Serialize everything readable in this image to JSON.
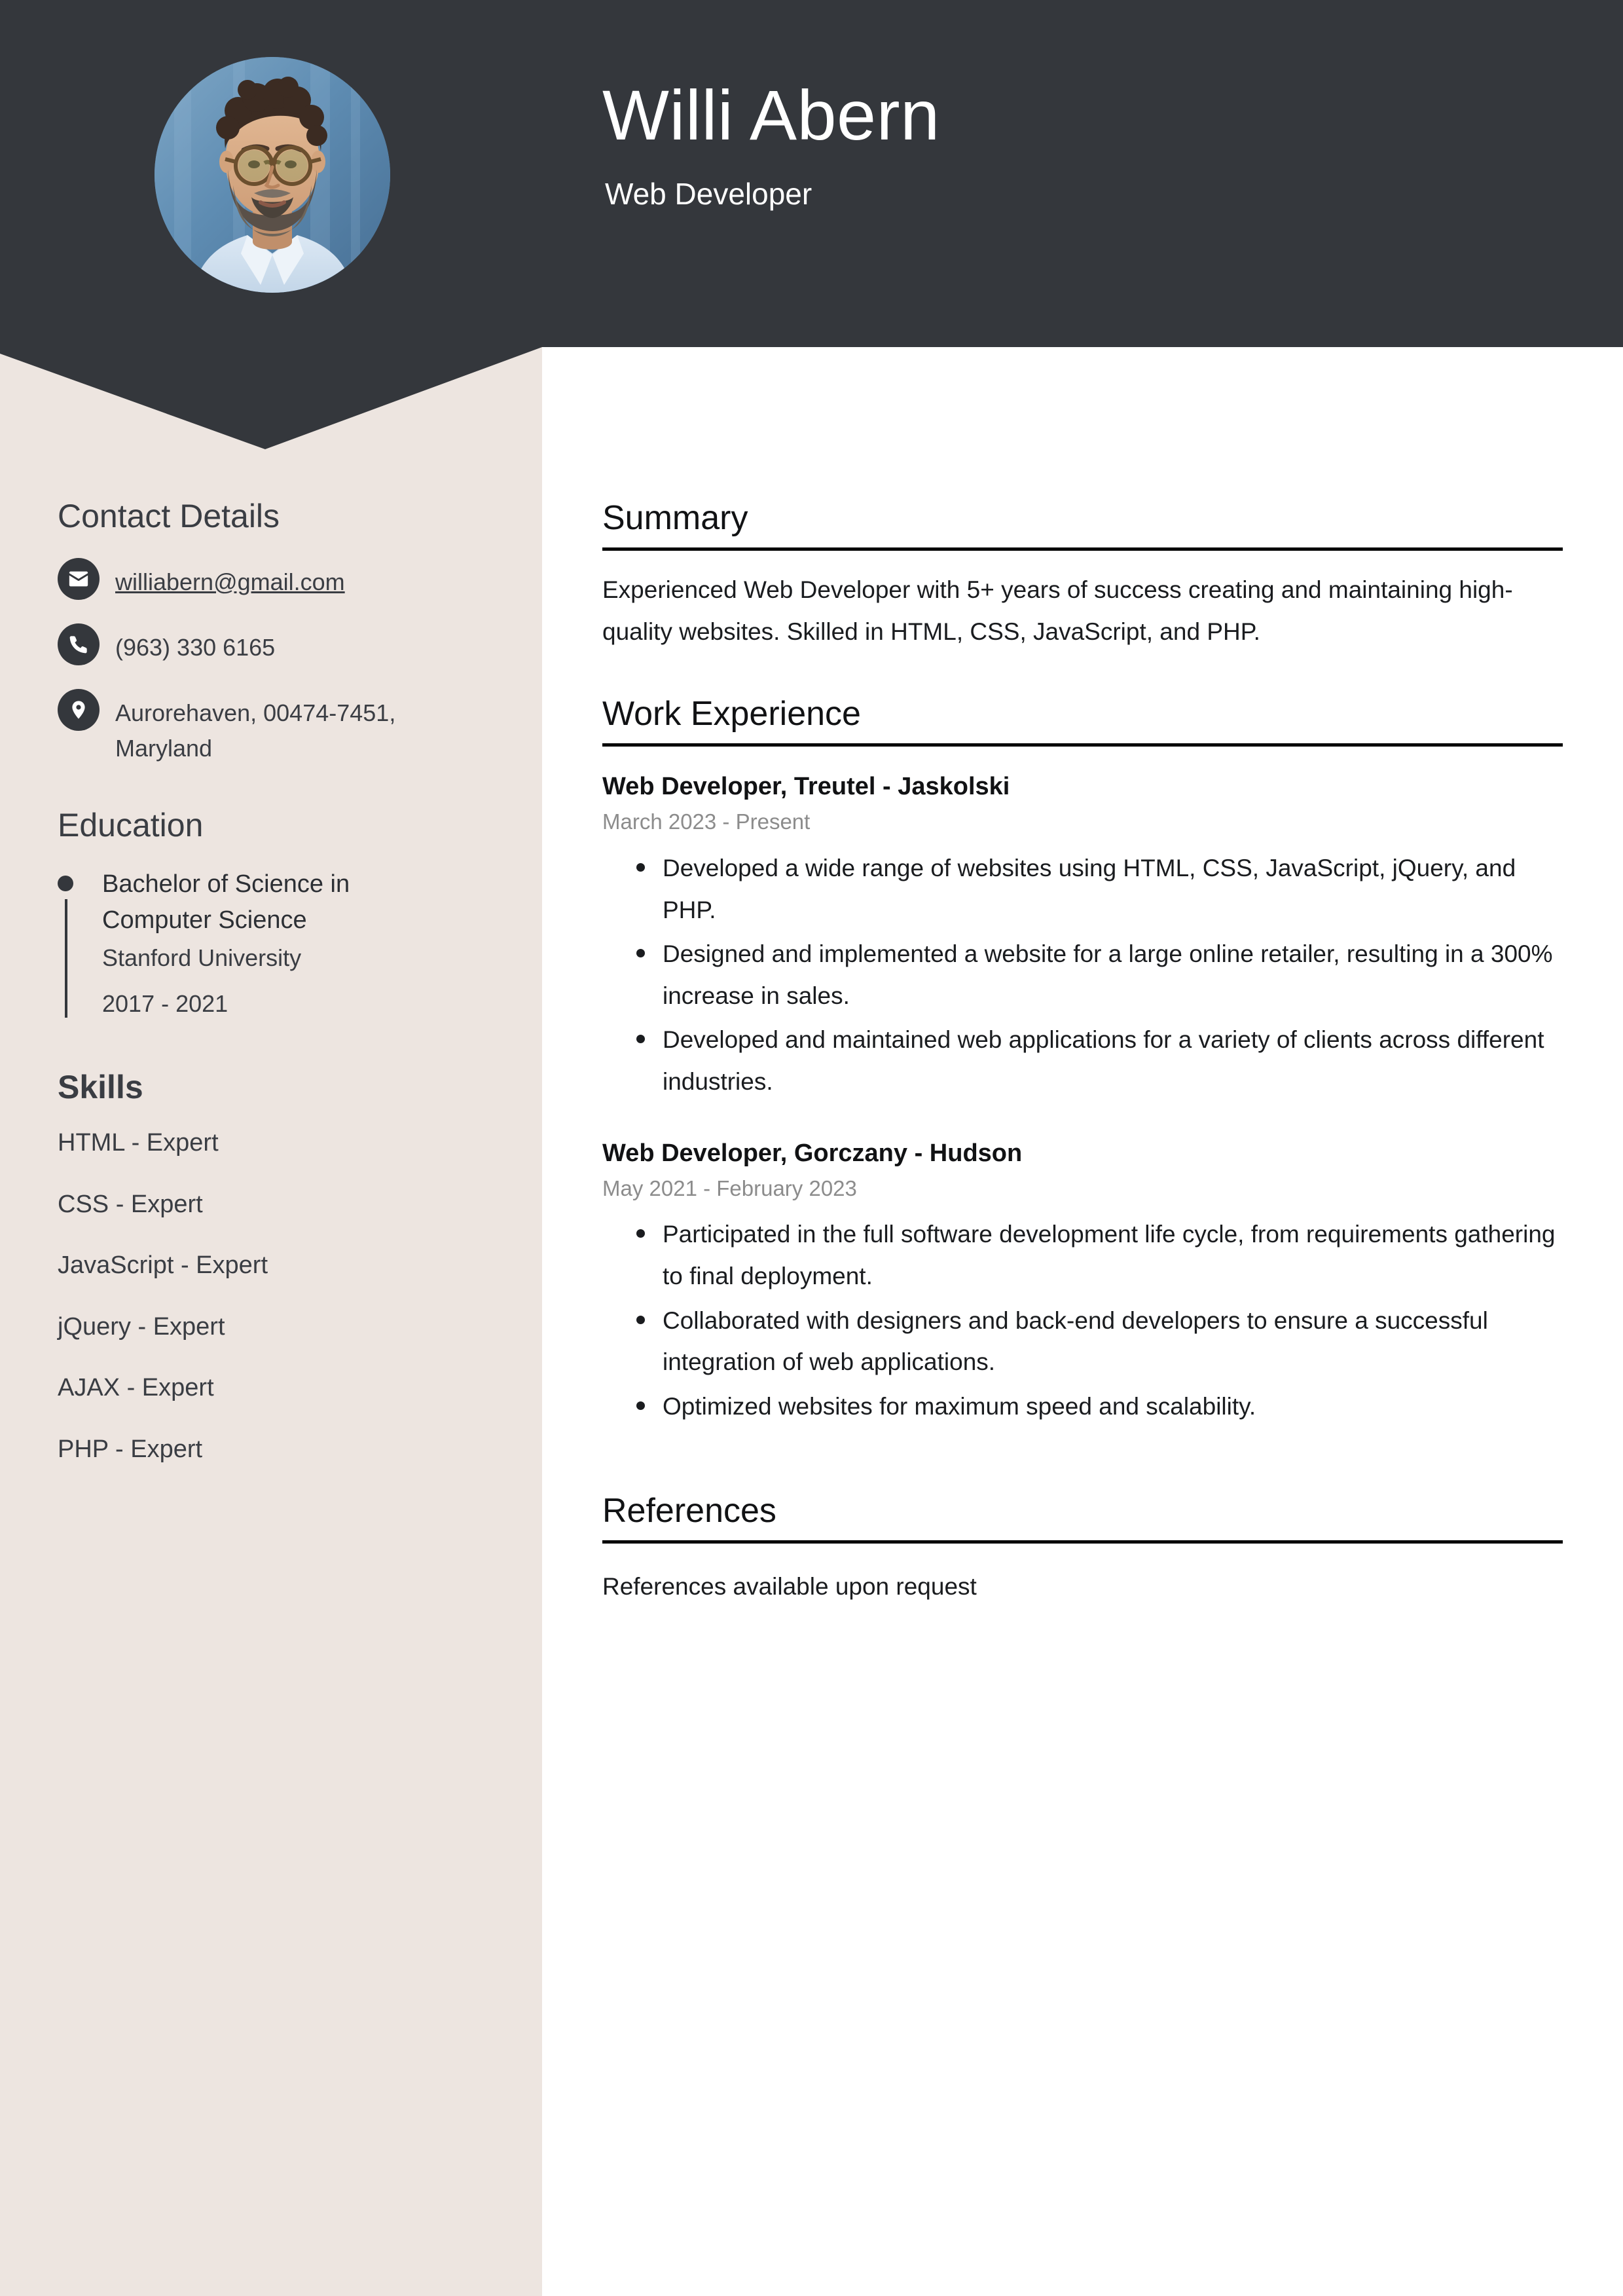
{
  "theme": {
    "header_bg": "#34373C",
    "sidebar_bg": "#EDE5E0",
    "main_bg": "#FFFFFF",
    "heading_color": "#111214",
    "muted_text": "#8C8C8C"
  },
  "header": {
    "name": "Willi Abern",
    "job_title": "Web Developer",
    "photo_alt": "profile-photo"
  },
  "sidebar": {
    "contact": {
      "heading": "Contact Details",
      "items": [
        {
          "icon": "envelope-icon",
          "value": "williabern@gmail.com",
          "is_link": true
        },
        {
          "icon": "phone-icon",
          "value": "(963) 330 6165",
          "is_link": false
        },
        {
          "icon": "location-pin-icon",
          "value": "Aurorehaven, 00474-7451, Maryland",
          "is_link": false
        }
      ]
    },
    "education": {
      "heading": "Education",
      "items": [
        {
          "degree": "Bachelor of Science in Computer Science",
          "school": "Stanford University",
          "years": "2017 - 2021"
        }
      ]
    },
    "skills": {
      "heading": "Skills",
      "items": [
        "HTML - Expert",
        "CSS - Expert",
        "JavaScript - Expert",
        "jQuery - Expert",
        "AJAX - Expert",
        "PHP - Expert"
      ]
    }
  },
  "main": {
    "summary": {
      "heading": "Summary",
      "text": "Experienced Web Developer with 5+ years of success creating and maintaining high-quality websites. Skilled in HTML, CSS, JavaScript, and PHP."
    },
    "work_experience": {
      "heading": "Work Experience",
      "jobs": [
        {
          "title": "Web Developer, Treutel - Jaskolski",
          "dates": "March 2023 - Present",
          "bullets": [
            "Developed a wide range of websites using HTML, CSS, JavaScript, jQuery, and PHP.",
            "Designed and implemented a website for a large online retailer, resulting in a 300% increase in sales.",
            "Developed and maintained web applications for a variety of clients across different industries."
          ]
        },
        {
          "title": "Web Developer, Gorczany - Hudson",
          "dates": "May 2021 - February 2023",
          "bullets": [
            "Participated in the full software development life cycle, from requirements gathering to final deployment.",
            "Collaborated with designers and back-end developers to ensure a successful integration of web applications.",
            "Optimized websites for maximum speed and scalability."
          ]
        }
      ]
    },
    "references": {
      "heading": "References",
      "text": "References available upon request"
    }
  }
}
